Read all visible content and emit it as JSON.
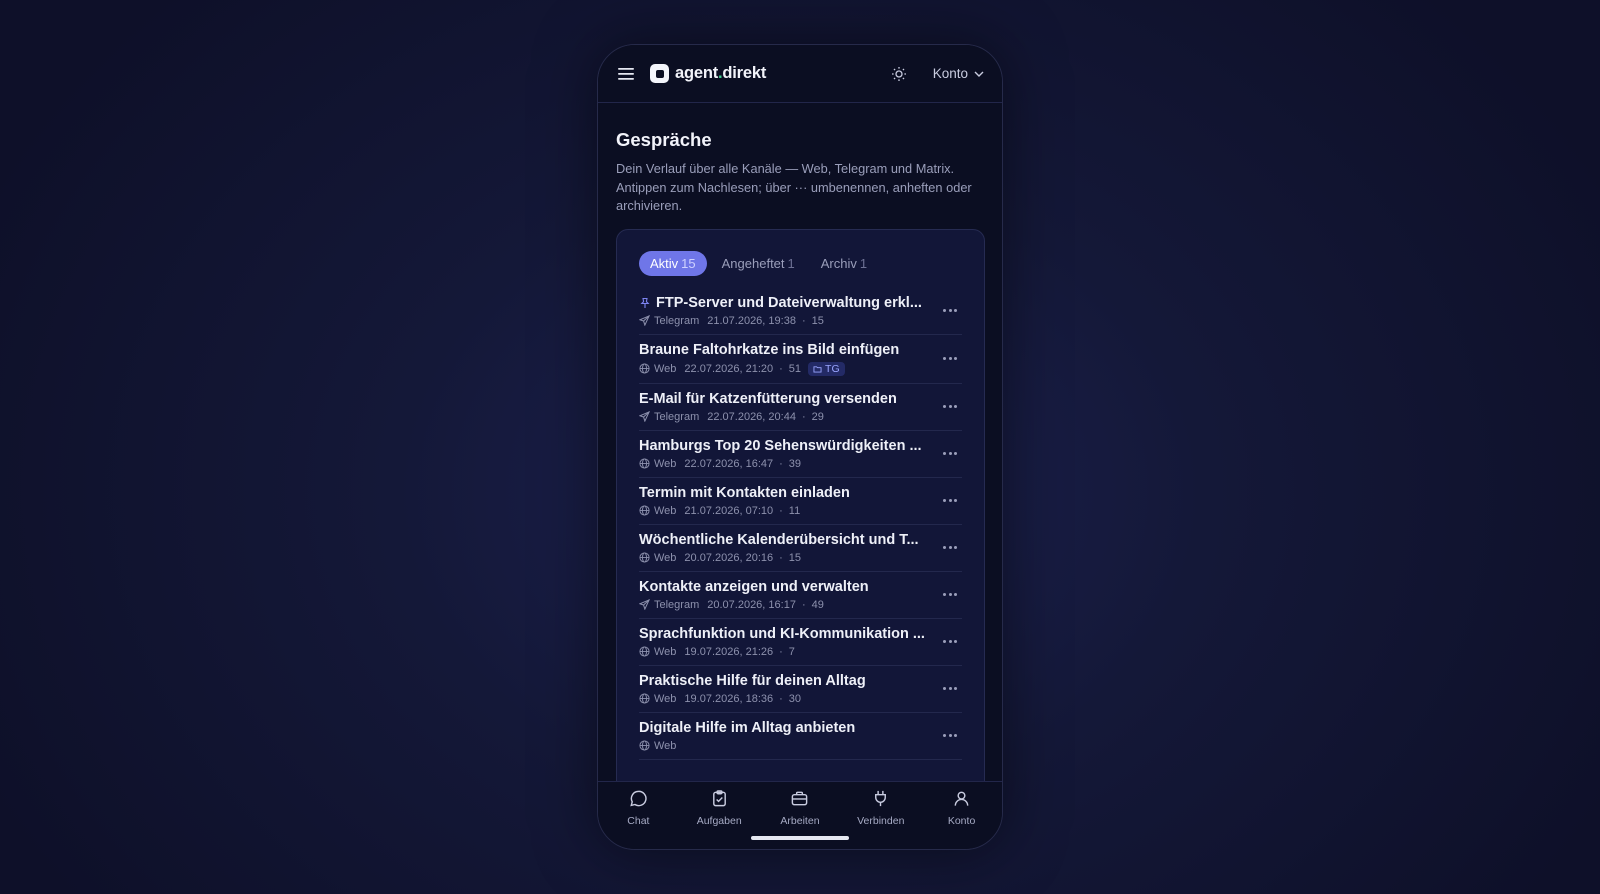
{
  "header": {
    "brand_part1": "agent",
    "brand_dot": ".",
    "brand_part2": "direkt",
    "account_label": "Konto"
  },
  "page": {
    "title": "Gespräche",
    "description": "Dein Verlauf über alle Kanäle — Web, Telegram und Matrix. Antippen zum Nachlesen; über ··· umbenennen, anheften oder archivieren."
  },
  "tabs": [
    {
      "label": "Aktiv",
      "count": "15",
      "active": true
    },
    {
      "label": "Angeheftet",
      "count": "1",
      "active": false
    },
    {
      "label": "Archiv",
      "count": "1",
      "active": false
    }
  ],
  "conversations": [
    {
      "title": "FTP-Server und Dateiverwaltung erkl...",
      "channel": "Telegram",
      "channel_icon": "telegram-icon",
      "date": "21.07.2026, 19:38",
      "count": "15",
      "pinned": true,
      "tag": ""
    },
    {
      "title": "Braune Faltohrkatze ins Bild einfügen",
      "channel": "Web",
      "channel_icon": "globe-icon",
      "date": "22.07.2026, 21:20",
      "count": "51",
      "pinned": false,
      "tag": "TG"
    },
    {
      "title": "E-Mail für Katzenfütterung versenden",
      "channel": "Telegram",
      "channel_icon": "telegram-icon",
      "date": "22.07.2026, 20:44",
      "count": "29",
      "pinned": false,
      "tag": ""
    },
    {
      "title": "Hamburgs Top 20 Sehenswürdigkeiten ...",
      "channel": "Web",
      "channel_icon": "globe-icon",
      "date": "22.07.2026, 16:47",
      "count": "39",
      "pinned": false,
      "tag": ""
    },
    {
      "title": "Termin mit Kontakten einladen",
      "channel": "Web",
      "channel_icon": "globe-icon",
      "date": "21.07.2026, 07:10",
      "count": "11",
      "pinned": false,
      "tag": ""
    },
    {
      "title": "Wöchentliche Kalenderübersicht und T...",
      "channel": "Web",
      "channel_icon": "globe-icon",
      "date": "20.07.2026, 20:16",
      "count": "15",
      "pinned": false,
      "tag": ""
    },
    {
      "title": "Kontakte anzeigen und verwalten",
      "channel": "Telegram",
      "channel_icon": "telegram-icon",
      "date": "20.07.2026, 16:17",
      "count": "49",
      "pinned": false,
      "tag": ""
    },
    {
      "title": "Sprachfunktion und KI-Kommunikation ...",
      "channel": "Web",
      "channel_icon": "globe-icon",
      "date": "19.07.2026, 21:26",
      "count": "7",
      "pinned": false,
      "tag": ""
    },
    {
      "title": "Praktische Hilfe für deinen Alltag",
      "channel": "Web",
      "channel_icon": "globe-icon",
      "date": "19.07.2026, 18:36",
      "count": "30",
      "pinned": false,
      "tag": ""
    },
    {
      "title": "Digitale Hilfe im Alltag anbieten",
      "channel": "Web",
      "channel_icon": "globe-icon",
      "date": "",
      "count": "",
      "pinned": false,
      "tag": ""
    }
  ],
  "bottom_nav": [
    {
      "label": "Chat",
      "icon": "chat-icon"
    },
    {
      "label": "Aufgaben",
      "icon": "clipboard-icon"
    },
    {
      "label": "Arbeiten",
      "icon": "briefcase-icon"
    },
    {
      "label": "Verbinden",
      "icon": "plug-icon"
    },
    {
      "label": "Konto",
      "icon": "user-icon"
    }
  ],
  "colors": {
    "accent": "#6f76e8",
    "brand_dot": "#3ecf8e",
    "background": "#0b0e22"
  }
}
